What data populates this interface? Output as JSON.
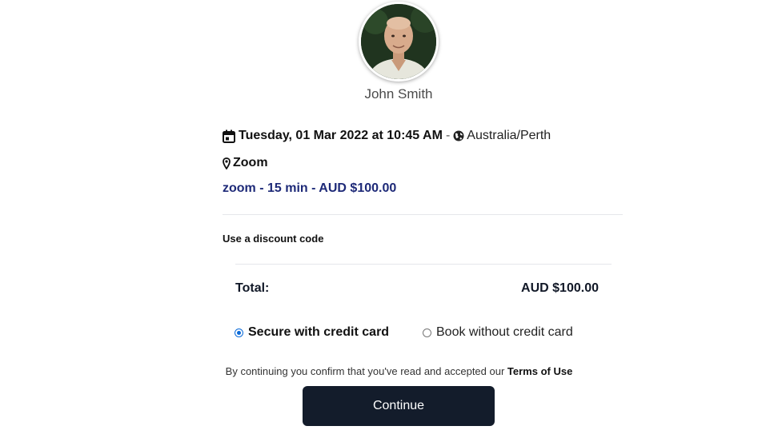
{
  "host": {
    "name": "John Smith"
  },
  "booking": {
    "datetime": "Tuesday, 01 Mar 2022 at 10:45 AM",
    "separator": "-",
    "timezone": "Australia/Perth",
    "location": "Zoom",
    "service": "zoom - 15 min - AUD $100.00"
  },
  "discount": {
    "label": "Use a discount code"
  },
  "total": {
    "label": "Total:",
    "value": "AUD $100.00"
  },
  "payment": {
    "options": [
      {
        "label": "Secure with credit card",
        "selected": true
      },
      {
        "label": "Book without credit card",
        "selected": false
      }
    ]
  },
  "consent": {
    "text": "By continuing you confirm that you've read and accepted our",
    "terms_link": "Terms of Use"
  },
  "continue_button": {
    "label": "Continue"
  },
  "colors": {
    "service_link": "#1e2a78",
    "button_bg": "#131c2b",
    "radio_accent": "#0b6ad8"
  }
}
